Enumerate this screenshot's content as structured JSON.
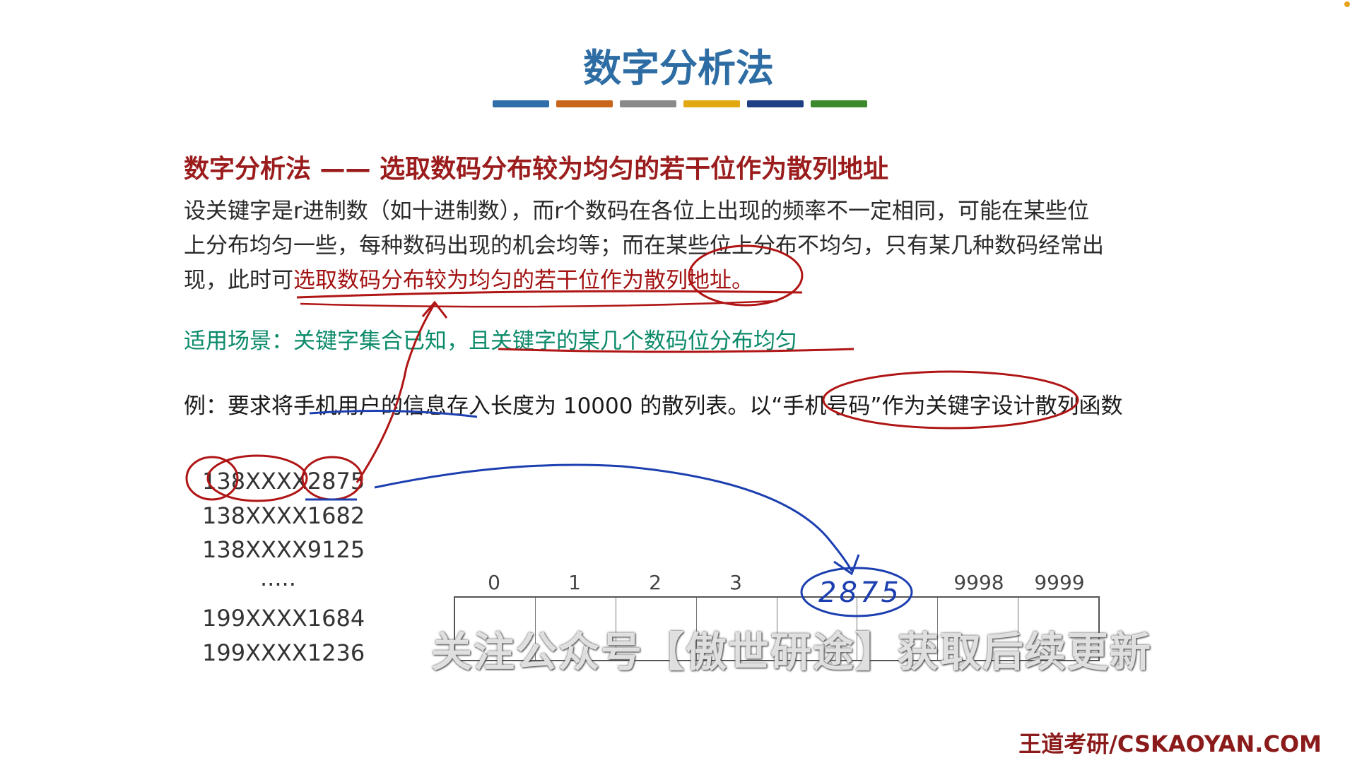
{
  "slide": {
    "title": "数字分析法",
    "colors": {
      "title": "#2e6da4",
      "bar": [
        "#2f6ea8",
        "#c8651b",
        "#8a8a8a",
        "#e2a812",
        "#1f3f85",
        "#3d8a2e"
      ]
    }
  },
  "heading": "数字分析法 —— 选取数码分布较为均匀的若干位作为散列地址",
  "paragraph": {
    "line1": "设关键字是r进制数（如十进制数），而r个数码在各位上出现的频率不一定相同，可能在某些位",
    "line2": "上分布均匀一些，每种数码出现的机会均等；而在某些位上分布不均匀，只有某几种数码经常出",
    "line3_prefix": "现，此时可",
    "line3_highlight": "选取数码分布较为均匀的若干位作为散列地址。"
  },
  "scenario": {
    "prefix": "适用场景：关键字集合已知，",
    "emphasis": "且关键字的某几个数码位分布均匀"
  },
  "example": "例：要求将手机用户的信息存入长度为 10000 的散列表。以“手机号码”作为关键字设计散列函数",
  "phone_numbers": [
    "138XXXX2875",
    "138XXXX1682",
    "138XXXX9125",
    "·····",
    "199XXXX1684",
    "199XXXX1236"
  ],
  "hash_table": {
    "indices": [
      "0",
      "1",
      "2",
      "3",
      "",
      "",
      "9998",
      "9999"
    ],
    "annotation_value": "2875"
  },
  "watermark": "关注公众号【傲世研途】获取后续更新",
  "brand": "王道考研/CSKAOYAN.COM"
}
